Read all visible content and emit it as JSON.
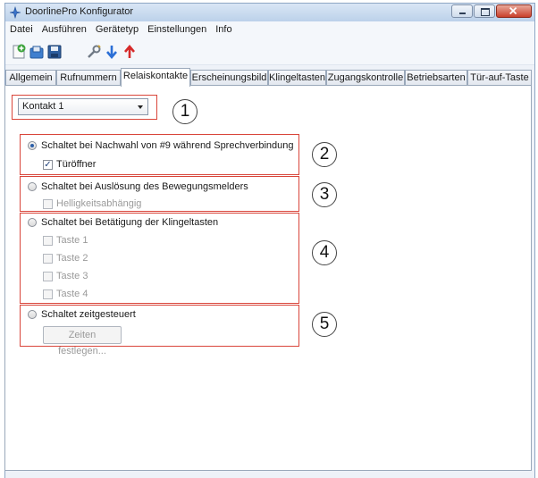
{
  "window": {
    "title": "DoorlinePro Konfigurator"
  },
  "menu": [
    "Datei",
    "Ausführen",
    "Gerätetyp",
    "Einstellungen",
    "Info"
  ],
  "toolbar_icons": [
    "new-icon",
    "save-as-icon",
    "save-icon",
    "tools-icon",
    "download-icon",
    "upload-icon"
  ],
  "tabs": [
    "Allgemein",
    "Rufnummern",
    "Relaiskontakte",
    "Erscheinungsbild",
    "Klingeltasten",
    "Zugangskontrolle",
    "Betriebsarten",
    "Tür-auf-Taste"
  ],
  "active_tab": "Relaiskontakte",
  "contact_select": {
    "value": "Kontakt 1"
  },
  "callouts": [
    "1",
    "2",
    "3",
    "4",
    "5"
  ],
  "options": {
    "dtmf": {
      "label": "Schaltet bei Nachwahl von #9 während Sprechverbindung",
      "checkbox": "Türöffner"
    },
    "motion": {
      "label": "Schaltet bei Auslösung des Bewegungsmelders",
      "checkbox": "Helligkeitsabhängig"
    },
    "bell": {
      "label": "Schaltet bei Betätigung der Klingeltasten",
      "keys": [
        "Taste 1",
        "Taste 2",
        "Taste 3",
        "Taste 4"
      ]
    },
    "timed": {
      "label": "Schaltet zeitgesteuert",
      "button": "Zeiten festlegen..."
    }
  },
  "colors": {
    "highlight_border": "#d9453a",
    "window_frame": "#bcd1ea"
  }
}
